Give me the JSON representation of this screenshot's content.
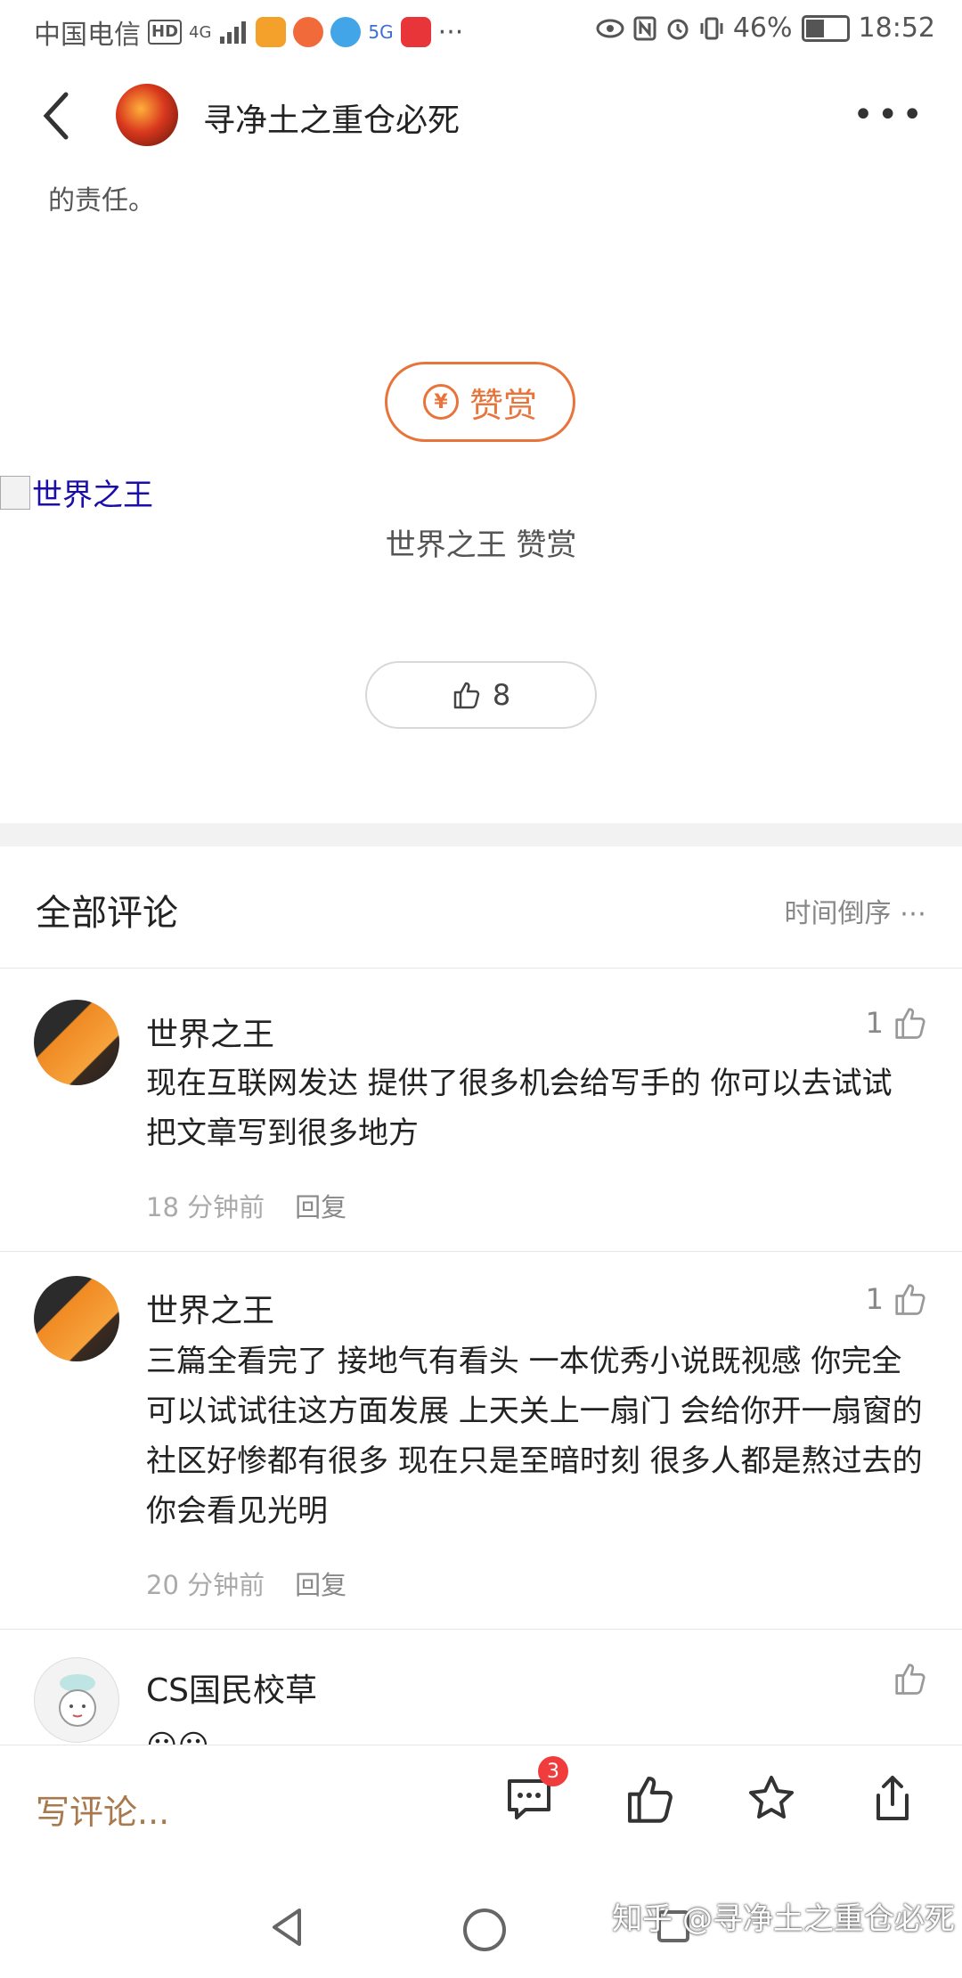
{
  "status_bar": {
    "carrier": "中国电信",
    "hd_label": "HD",
    "network": "4G",
    "signal_label": "5G",
    "battery_percent": "46%",
    "time": "18:52",
    "more": "···"
  },
  "header": {
    "author_name": "寻净土之重仓必死",
    "more": "•••"
  },
  "article": {
    "tail_text": "的责任。",
    "tip_button": "赞赏",
    "tip_coin": "¥",
    "tipper_image_alt": "世界之王",
    "tip_record": "世界之王 赞赏",
    "like_count": "8"
  },
  "comments_section": {
    "title": "全部评论",
    "sort_label": "时间倒序 ⋯",
    "comments": [
      {
        "name": "世界之王",
        "likes": "1",
        "text": "现在互联网发达 提供了很多机会给写手的 你可以去试试 把文章写到很多地方",
        "time": "18 分钟前",
        "reply": "回复"
      },
      {
        "name": "世界之王",
        "likes": "1",
        "text": "三篇全看完了 接地气有看头 一本优秀小说既视感 你完全可以试试往这方面发展 上天关上一扇门 会给你开一扇窗的 社区好惨都有很多 现在只是至暗时刻 很多人都是熬过去的 你会看见光明",
        "time": "20 分钟前",
        "reply": "回复"
      },
      {
        "name": "CS国民校草",
        "likes": "",
        "text": "😀😀",
        "time": "",
        "reply": ""
      }
    ]
  },
  "bottom_bar": {
    "write_placeholder": "写评论...",
    "comment_count_badge": "3"
  },
  "watermark": "知乎 @寻净土之重仓必死",
  "colors": {
    "accent_orange": "#e8743b",
    "write_brown": "#a9784c",
    "badge_red": "#f03c3c"
  }
}
